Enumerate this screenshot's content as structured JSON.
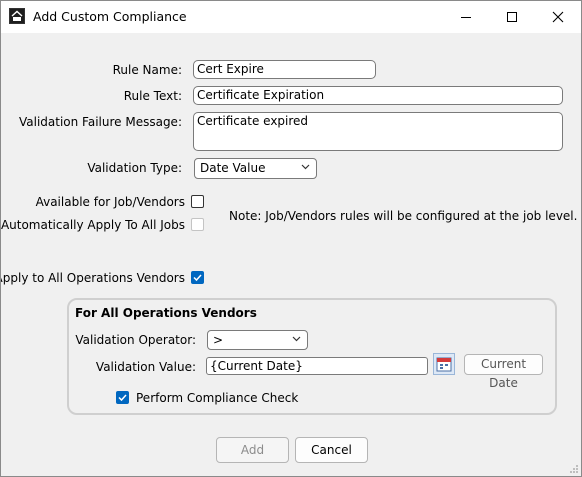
{
  "window": {
    "title": "Add Custom Compliance",
    "icon": "app-logo-icon"
  },
  "form": {
    "rule_name": {
      "label": "Rule Name:",
      "value": "Cert Expire"
    },
    "rule_text": {
      "label": "Rule Text:",
      "value": "Certificate Expiration"
    },
    "failure_message": {
      "label": "Validation Failure Message:",
      "value": "Certificate expired"
    },
    "validation_type": {
      "label": "Validation Type:",
      "value": "Date Value"
    },
    "available_for_job": {
      "label": "Available for Job/Vendors",
      "checked": false
    },
    "auto_apply": {
      "label": "Automatically Apply To All Jobs",
      "checked": false,
      "disabled": true
    },
    "note": "Note:  Job/Vendors rules will be configured at the job level.",
    "apply_all_ops": {
      "label": "Apply to All Operations Vendors",
      "checked": true
    }
  },
  "group": {
    "title": "For All Operations Vendors",
    "operator": {
      "label": "Validation Operator:",
      "value": ">"
    },
    "value": {
      "label": "Validation Value:",
      "value": "{Current Date}",
      "button": "Current Date"
    },
    "perform_check": {
      "label": "Perform Compliance Check",
      "checked": true
    }
  },
  "buttons": {
    "add": "Add",
    "cancel": "Cancel"
  },
  "colors": {
    "accent": "#0067c0",
    "group_border": "#cfcfcf"
  }
}
